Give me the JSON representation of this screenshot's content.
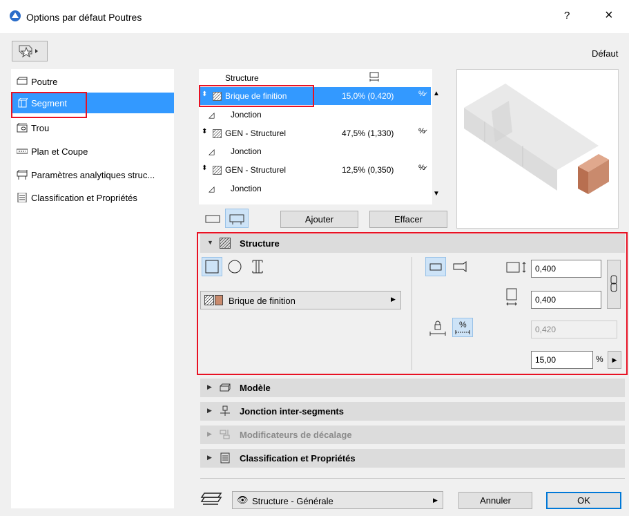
{
  "window": {
    "title": "Options par défaut Poutres",
    "help": "?",
    "close": "×"
  },
  "toolbar": {
    "default_label": "Défaut"
  },
  "nav": {
    "items": [
      {
        "label": "Poutre"
      },
      {
        "label": "Segment"
      },
      {
        "label": "Trou"
      },
      {
        "label": "Plan et Coupe"
      },
      {
        "label": "Paramètres analytiques struc..."
      },
      {
        "label": "Classification et Propriétés"
      }
    ]
  },
  "segments": {
    "header": "Structure",
    "rows": [
      {
        "type": "segment",
        "name": "Brique de finition",
        "value": "15,0% (0,420)"
      },
      {
        "type": "junction",
        "name": "Jonction"
      },
      {
        "type": "segment",
        "name": "GEN - Structurel",
        "value": "47,5% (1,330)"
      },
      {
        "type": "junction",
        "name": "Jonction"
      },
      {
        "type": "segment",
        "name": "GEN - Structurel",
        "value": "12,5% (0,350)"
      },
      {
        "type": "junction",
        "name": "Jonction"
      }
    ],
    "add_label": "Ajouter",
    "delete_label": "Effacer"
  },
  "structure_panel": {
    "title": "Structure",
    "material": "Brique de finition",
    "width": "0,400",
    "height": "0,400",
    "length": "0,420",
    "percent": "15,00",
    "percent_unit": "%"
  },
  "panels": [
    {
      "label": "Modèle",
      "enabled": true
    },
    {
      "label": "Jonction inter-segments",
      "enabled": true
    },
    {
      "label": "Modificateurs de décalage",
      "enabled": false
    },
    {
      "label": "Classification et Propriétés",
      "enabled": true
    }
  ],
  "footer": {
    "layer": "Structure - Générale",
    "cancel_label": "Annuler",
    "ok_label": "OK"
  },
  "colors": {
    "selection": "#3399ff",
    "highlight": "#e81123",
    "brick": "#c98a6d"
  }
}
